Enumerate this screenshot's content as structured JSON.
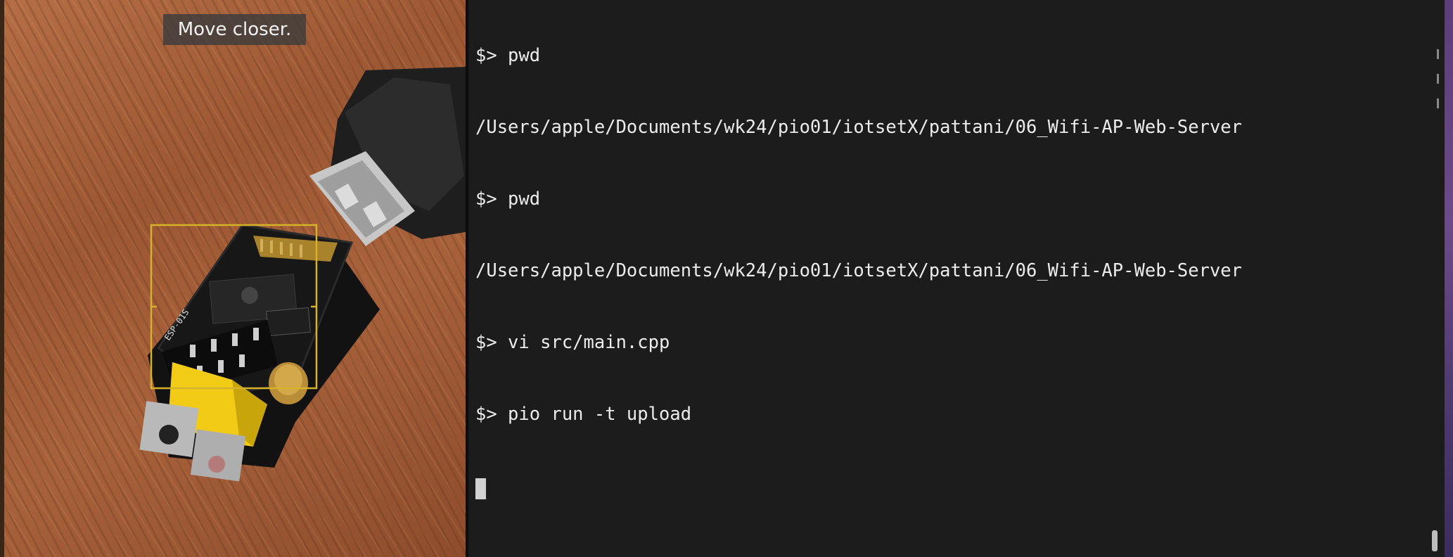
{
  "camera": {
    "hint_text": "Move closer."
  },
  "terminal": {
    "lines": [
      "$> pwd",
      "/Users/apple/Documents/wk24/pio01/iotsetX/pattani/06_Wifi-AP-Web-Server",
      "$> pwd",
      "/Users/apple/Documents/wk24/pio01/iotsetX/pattani/06_Wifi-AP-Web-Server",
      "$> vi src/main.cpp",
      "$> pio run -t upload"
    ]
  },
  "colors": {
    "terminal_bg": "#1c1c1c",
    "terminal_text": "#ececec",
    "focus_box": "#d6b22a",
    "hint_bg": "#3c3c3c"
  }
}
